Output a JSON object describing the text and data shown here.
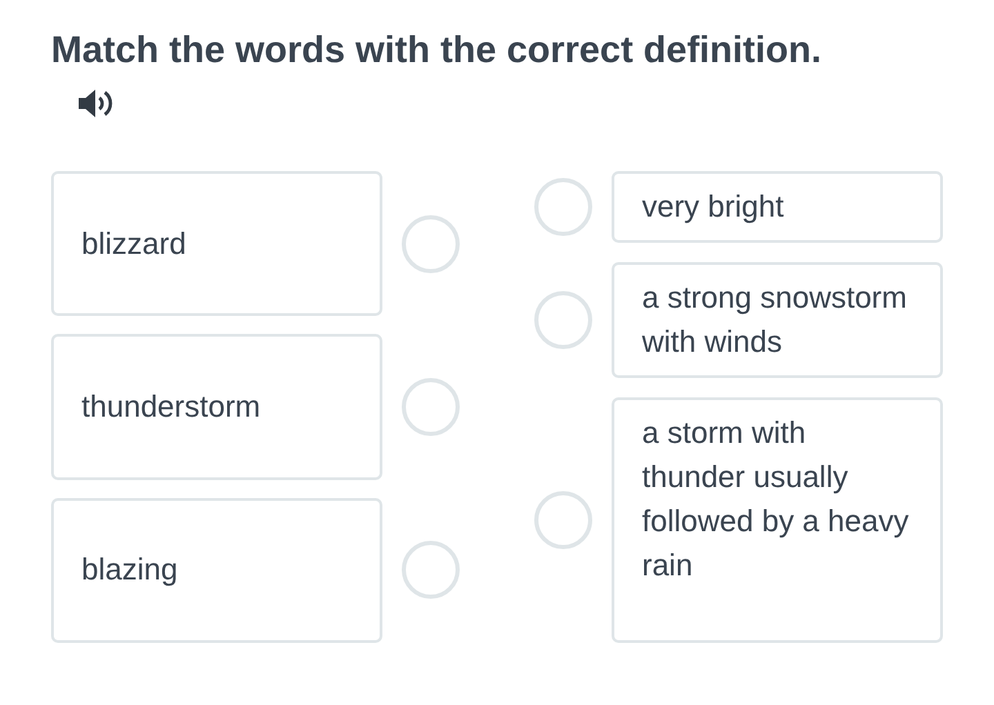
{
  "title": "Match the words with the correct definition.",
  "audio": {
    "kind": "speaker"
  },
  "words": [
    {
      "text": "blizzard"
    },
    {
      "text": "thunderstorm"
    },
    {
      "text": "blazing"
    }
  ],
  "definitions": [
    {
      "text": "very bright"
    },
    {
      "text": "a strong snowstorm with winds"
    },
    {
      "text": "a storm with thunder usually followed by a heavy rain"
    }
  ]
}
